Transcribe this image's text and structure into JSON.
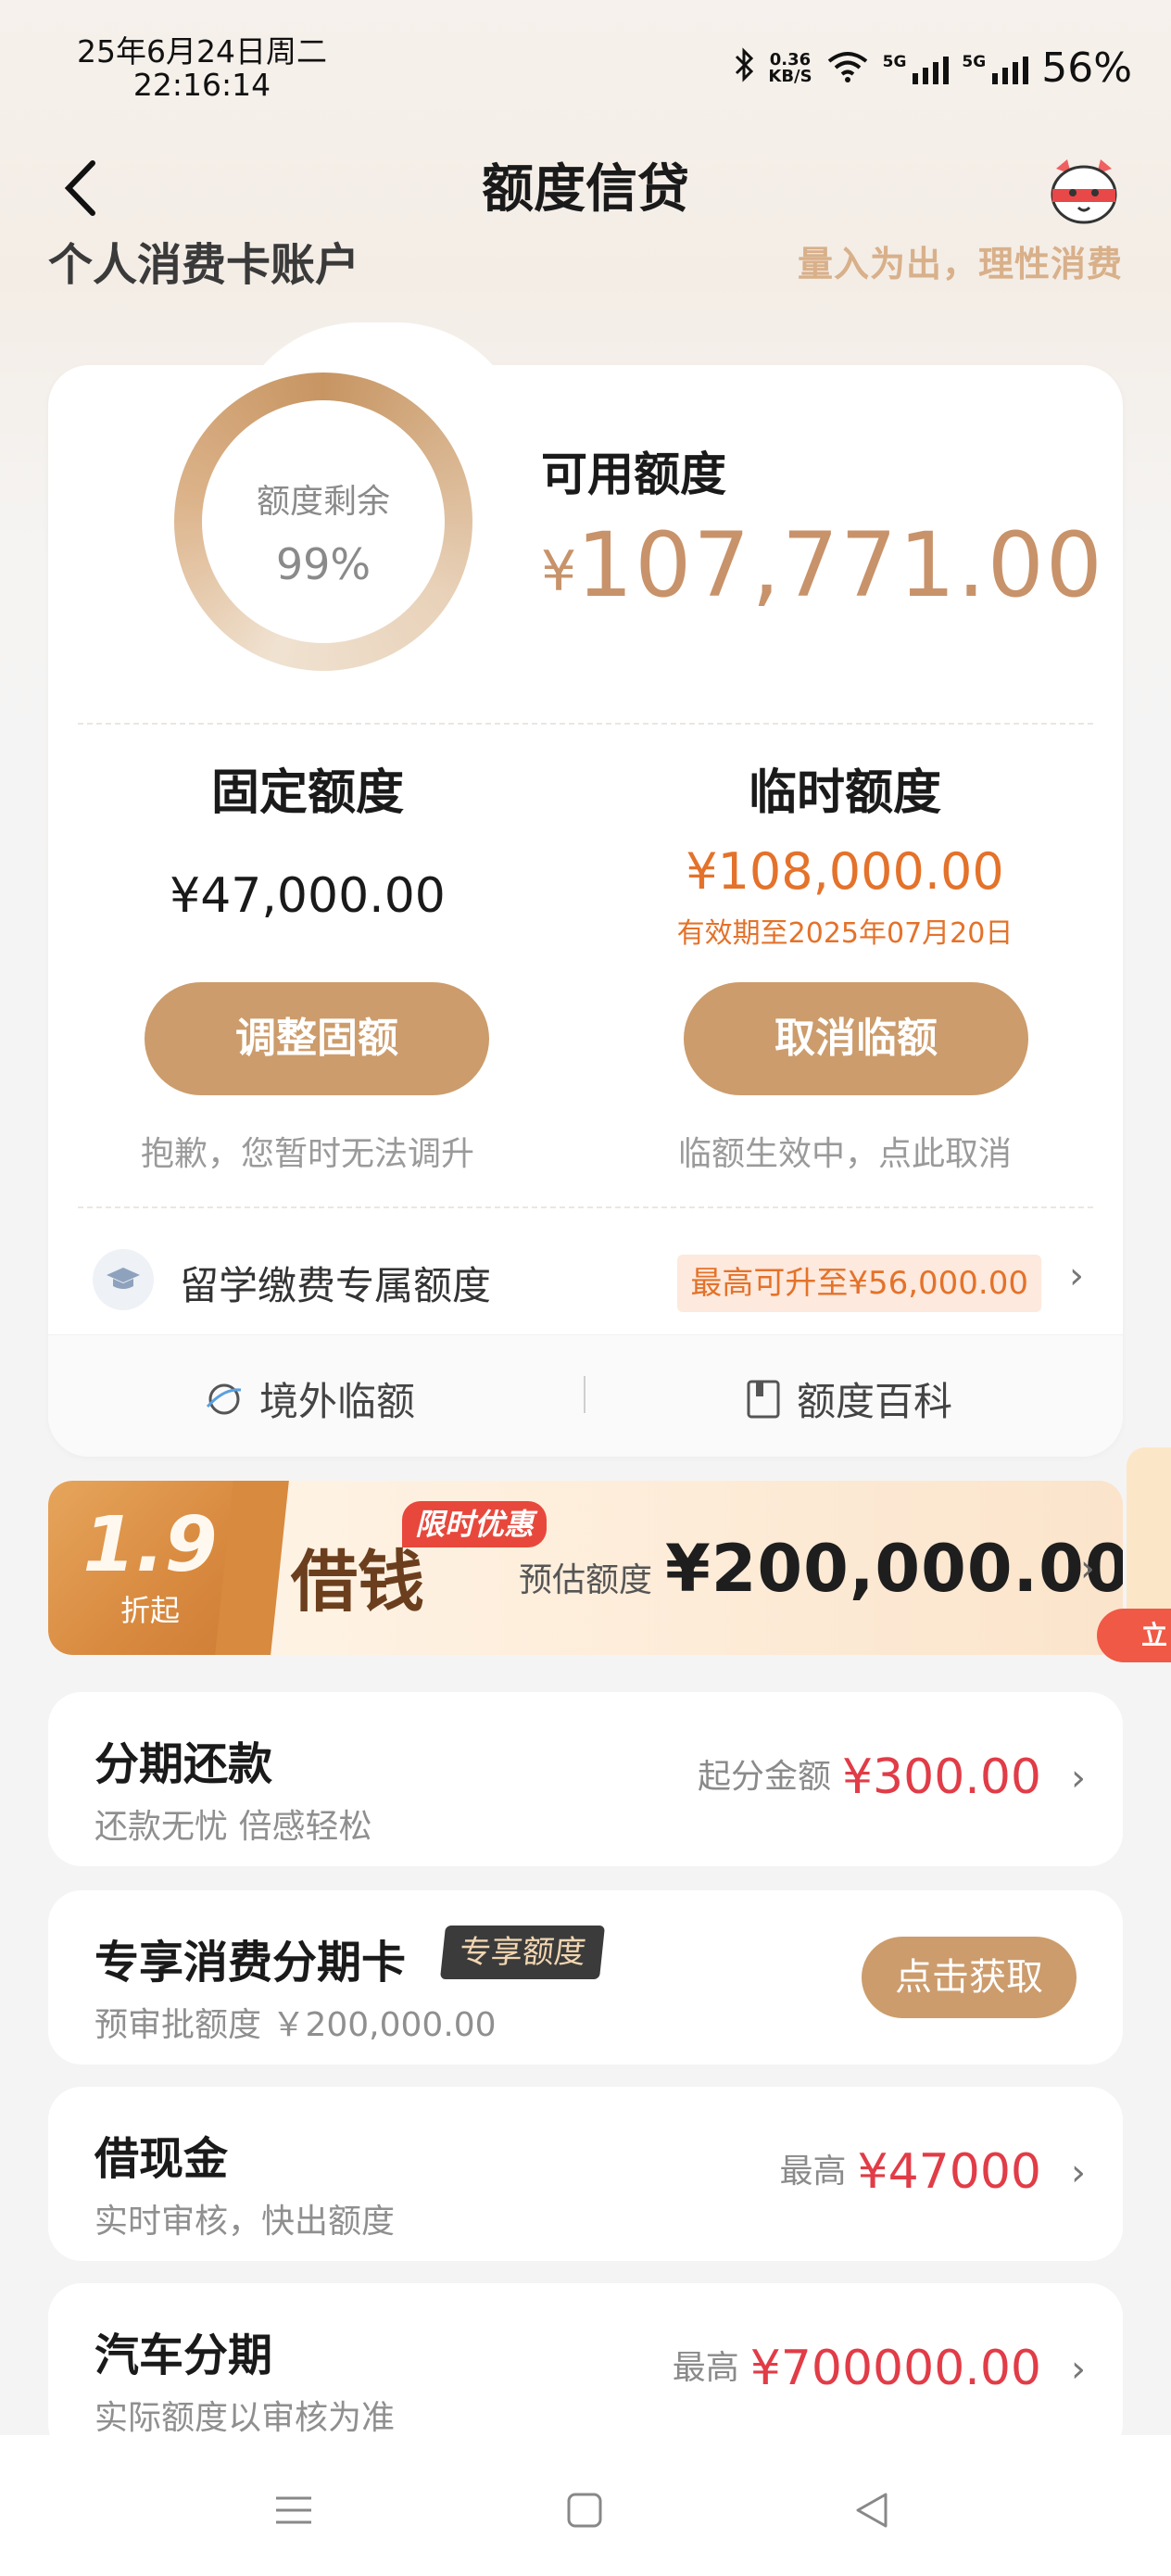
{
  "status_bar": {
    "date_line": "25年6月24日周二",
    "time_line": "22:16:14",
    "net_speed_top": "0.36",
    "net_speed_bottom": "KB/S",
    "signal_1": "5G",
    "signal_2": "5G",
    "battery": "56%"
  },
  "header": {
    "title": "额度信贷",
    "account_label": "个人消费卡账户",
    "slogan": "量入为出，理性消费"
  },
  "credit": {
    "ring_label": "额度剩余",
    "ring_value": "99%",
    "available_label": "可用额度",
    "available_currency": "¥",
    "available_amount": "107,771.00",
    "fixed": {
      "title": "固定额度",
      "amount": "¥47,000.00",
      "button": "调整固额",
      "note": "抱歉，您暂时无法调升"
    },
    "temporary": {
      "title": "临时额度",
      "amount": "¥108,000.00",
      "expiry": "有效期至2025年07月20日",
      "button": "取消临额",
      "note": "临额生效中，点此取消"
    },
    "study": {
      "label": "留学缴费专属额度",
      "badge": "最高可升至¥56,000.00"
    },
    "footer": {
      "overseas": "境外临额",
      "wiki": "额度百科"
    }
  },
  "loan_banner": {
    "discount_num": "1.9",
    "discount_sub": "折起",
    "title": "借钱",
    "promo_tag": "限时优惠",
    "est_label": "预估额度",
    "amount": "¥200,000.00",
    "float_side_text": "立"
  },
  "list": [
    {
      "title": "分期还款",
      "sub": "还款无忧 倍感轻松",
      "right_label": "起分金额",
      "right_value": "¥300.00"
    },
    {
      "title": "专享消费分期卡",
      "sub": "预审批额度 ￥200,000.00",
      "tag": "专享额度",
      "button": "点击获取"
    },
    {
      "title": "借现金",
      "sub": "实时审核，快出额度",
      "right_label": "最高",
      "right_value": "¥47000"
    },
    {
      "title": "汽车分期",
      "sub": "实际额度以审核为准",
      "right_label": "最高",
      "right_value": "¥700000.00"
    }
  ],
  "colors": {
    "accent_gold": "#cc9c6c",
    "amount_gold": "#c8936a",
    "orange": "#e4722a",
    "red": "#e13c47"
  }
}
